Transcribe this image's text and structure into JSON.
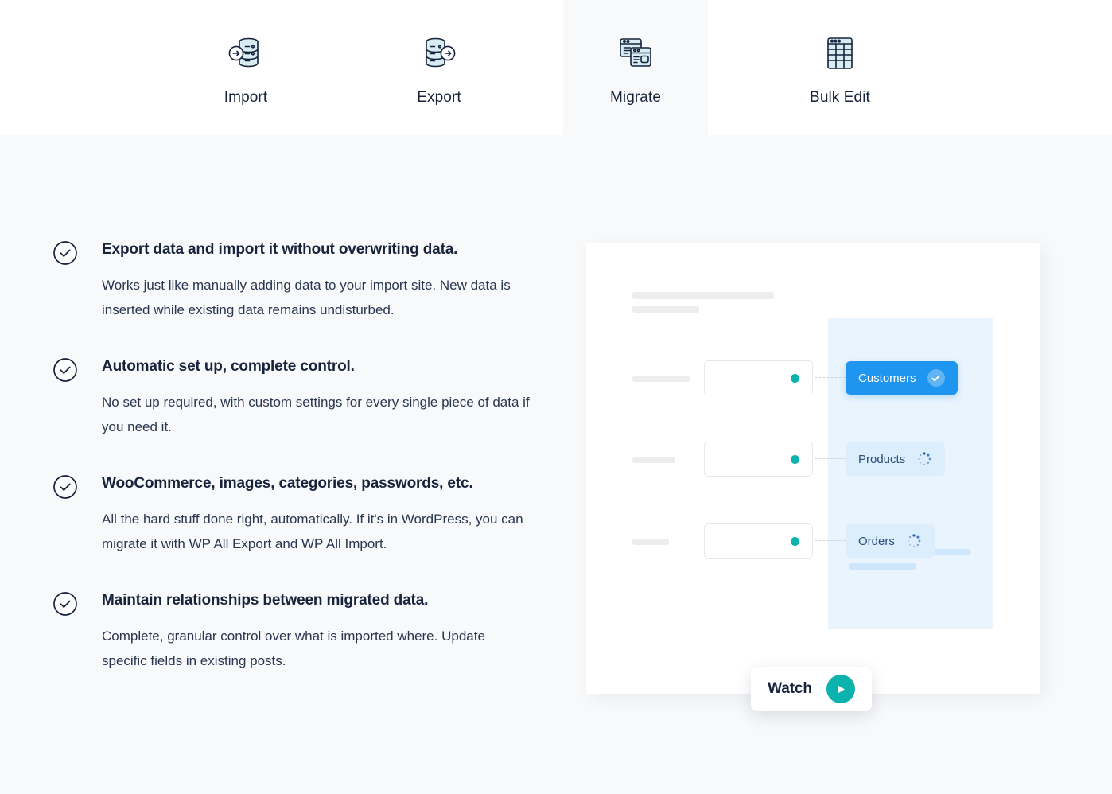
{
  "tabs": [
    {
      "label": "Import",
      "icon": "database-import-icon",
      "active": false
    },
    {
      "label": "Export",
      "icon": "database-export-icon",
      "active": false
    },
    {
      "label": "Migrate",
      "icon": "two-windows-icon",
      "active": true
    },
    {
      "label": "Bulk Edit",
      "icon": "spreadsheet-icon",
      "active": false
    }
  ],
  "features": [
    {
      "icon": "check-circle-icon",
      "title": "Export data and import it without overwriting data.",
      "desc": "Works just like manually adding data to your import site. New data is inserted while existing data remains undisturbed."
    },
    {
      "icon": "check-circle-icon",
      "title": "Automatic set up, complete control.",
      "desc": "No set up required, with custom settings for every single piece of data if you need it."
    },
    {
      "icon": "check-circle-icon",
      "title": "WooCommerce, images, categories, passwords, etc.",
      "desc": "All the hard stuff done right, automatically. If it's in WordPress, you can migrate it with WP All Export and WP All Import."
    },
    {
      "icon": "check-circle-icon",
      "title": "Maintain relationships between migrated data.",
      "desc": "Complete, granular control over what is imported where. Update specific fields in existing posts."
    }
  ],
  "illustration": {
    "rows": [
      {
        "chip_label": "Customers",
        "chip_state": "active",
        "chip_icon": "check-circle-icon",
        "dot_icon": "status-dot-icon"
      },
      {
        "chip_label": "Products",
        "chip_state": "pending",
        "chip_icon": "spinner-icon",
        "dot_icon": "status-dot-icon"
      },
      {
        "chip_label": "Orders",
        "chip_state": "pending",
        "chip_icon": "spinner-icon",
        "dot_icon": "status-dot-icon"
      }
    ],
    "watch": {
      "label": "Watch",
      "icon": "play-icon"
    }
  },
  "colors": {
    "page_background": "#f7f9fb",
    "tab_background": "#ffffff",
    "text_primary": "#17223b",
    "chip_active": "#1e96f0",
    "chip_pending_bg": "#dceefc",
    "chip_pending_text": "#2d4d79",
    "accent_teal": "#0bb3ac",
    "panel_blue": "#eaf4fd",
    "skeleton_gray": "#ebedef",
    "skeleton_blue": "#cde6fb"
  }
}
